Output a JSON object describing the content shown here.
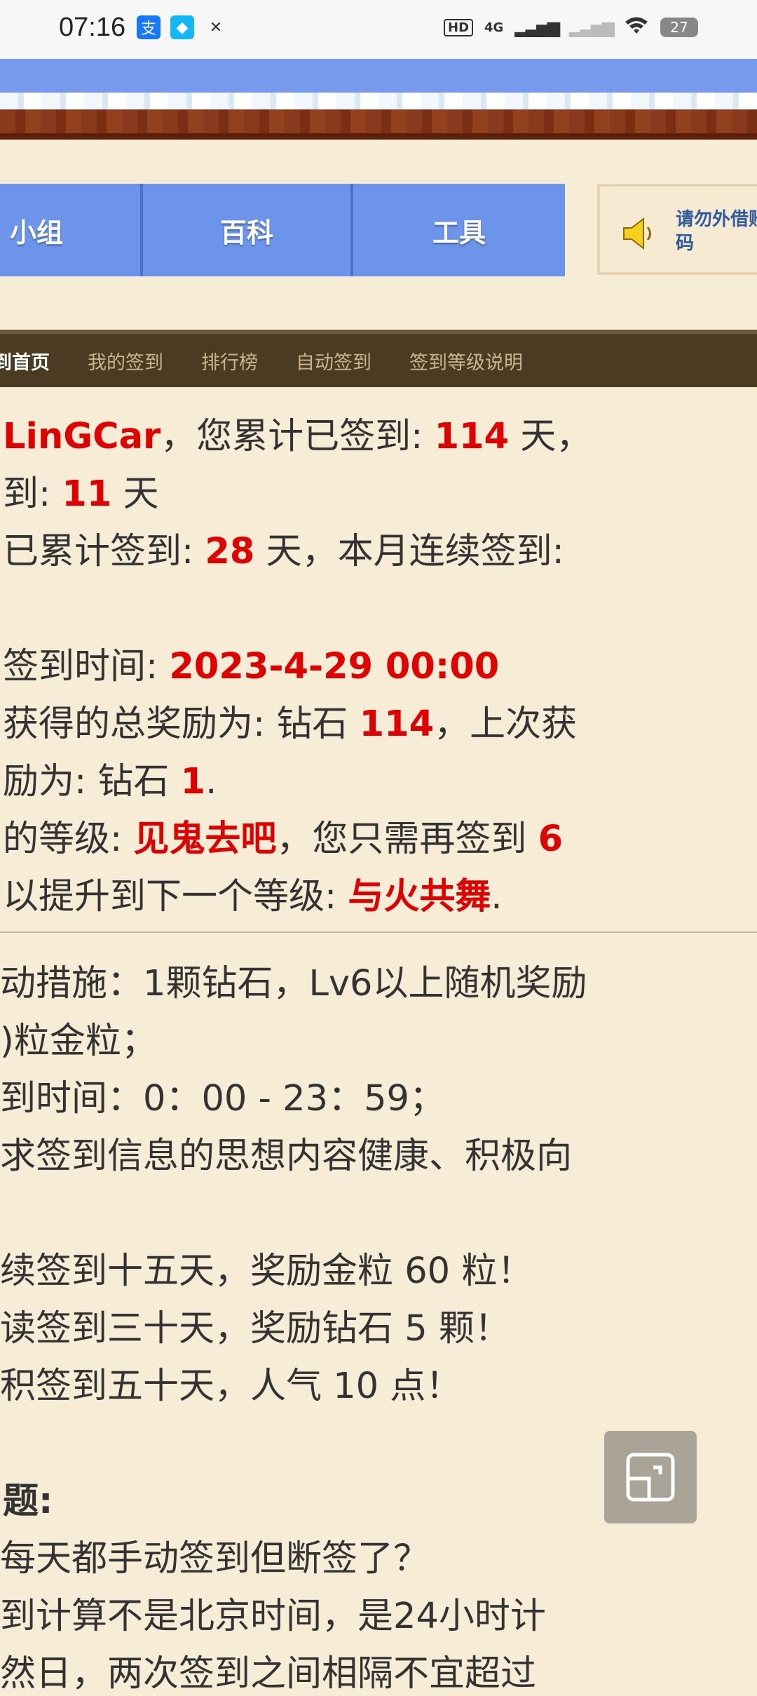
{
  "status_bar": {
    "time": "07:16",
    "indicators": [
      "HD",
      "4G",
      "wifi-icon"
    ],
    "battery": "27"
  },
  "top_nav": {
    "tabs": [
      "小组",
      "百科",
      "工具"
    ],
    "notice_text": "请勿外借账\n码"
  },
  "sub_nav": {
    "items": [
      "到首页",
      "我的签到",
      "排行榜",
      "自动签到",
      "签到等级说明"
    ]
  },
  "signin": {
    "l1": {
      "a": "LinGCar",
      "b": "，您累计已签到: ",
      "c": "114",
      "d": " 天，"
    },
    "l2": {
      "a": "到: ",
      "b": "11",
      "c": " 天"
    },
    "l3": {
      "a": "已累计签到: ",
      "b": "28",
      "c": " 天，本月连续签到:"
    },
    "l4": {
      "a": "签到时间: ",
      "b": "2023-4-29 00:00"
    },
    "l5": {
      "a": "获得的总奖励为: 钻石 ",
      "b": "114",
      "c": "，上次获"
    },
    "l6": {
      "a": "励为: 钻石 ",
      "b": "1",
      "c": "."
    },
    "l7": {
      "a": "的等级: ",
      "b": "见鬼去吧",
      "c": "，您只需再签到 ",
      "d": "6"
    },
    "l8": {
      "a": "以提升到下一个等级: ",
      "b": "与火共舞",
      "c": "."
    }
  },
  "rules": {
    "r1": "动措施：1颗钻石，Lv6以上随机奖励",
    "r2": ")粒金粒；",
    "r3": "到时间：0：00 - 23：59；",
    "r4": "求签到信息的思想内容健康、积极向",
    "r5": "续签到十五天，奖励金粒 60 粒！",
    "r6": "读签到三十天，奖励钻石 5 颗！",
    "r7": "积签到五十天，人气 10 点！",
    "r8": "题:",
    "r9": "每天都手动签到但断签了？",
    "r10": "到计算不是北京时间，是24小时计",
    "r11": "然日，两次签到之间相隔不宜超过"
  },
  "colors": {
    "accent_red": "#e00000",
    "nav_blue": "#6b94ea",
    "subnav_bg": "#4a3b22",
    "page_bg": "#f7ecd6"
  }
}
